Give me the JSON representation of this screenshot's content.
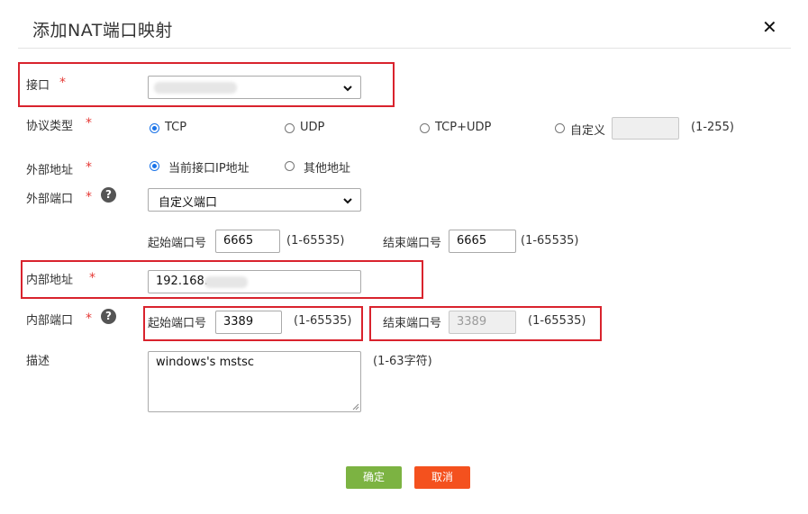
{
  "dialog": {
    "title": "添加NAT端口映射",
    "close_icon": "close-icon",
    "required_mark": "*"
  },
  "interface": {
    "label": "接口"
  },
  "protocol": {
    "label": "协议类型",
    "options": [
      "TCP",
      "UDP",
      "TCP+UDP",
      "自定义"
    ],
    "selected": "TCP",
    "custom_range": "(1-255)",
    "custom_value": ""
  },
  "external_address": {
    "label": "外部地址",
    "options": [
      "当前接口IP地址",
      "其他地址"
    ],
    "selected": "当前接口IP地址"
  },
  "external_port": {
    "label": "外部端口",
    "help_glyph": "?",
    "select_value": "自定义端口",
    "start_label": "起始端口号",
    "start_value": "6665",
    "start_range": "(1-65535)",
    "end_label": "结束端口号",
    "end_value": "6665",
    "end_range": "(1-65535)"
  },
  "internal_address": {
    "label": "内部地址",
    "value": "192.168."
  },
  "internal_port": {
    "label": "内部端口",
    "help_glyph": "?",
    "start_label": "起始端口号",
    "start_value": "3389",
    "start_range": "(1-65535)",
    "end_label": "结束端口号",
    "end_value": "3389",
    "end_range": "(1-65535)"
  },
  "description": {
    "label": "描述",
    "value": "windows's mstsc",
    "hint": "(1-63字符)"
  },
  "footer": {
    "ok_label": "确定",
    "cancel_label": "取消"
  },
  "colors": {
    "required": "#e53935",
    "highlight_box": "#d9232d",
    "ok_button": "#7cb342",
    "cancel_button": "#f4511e",
    "radio_checked": "#1a73e8"
  }
}
